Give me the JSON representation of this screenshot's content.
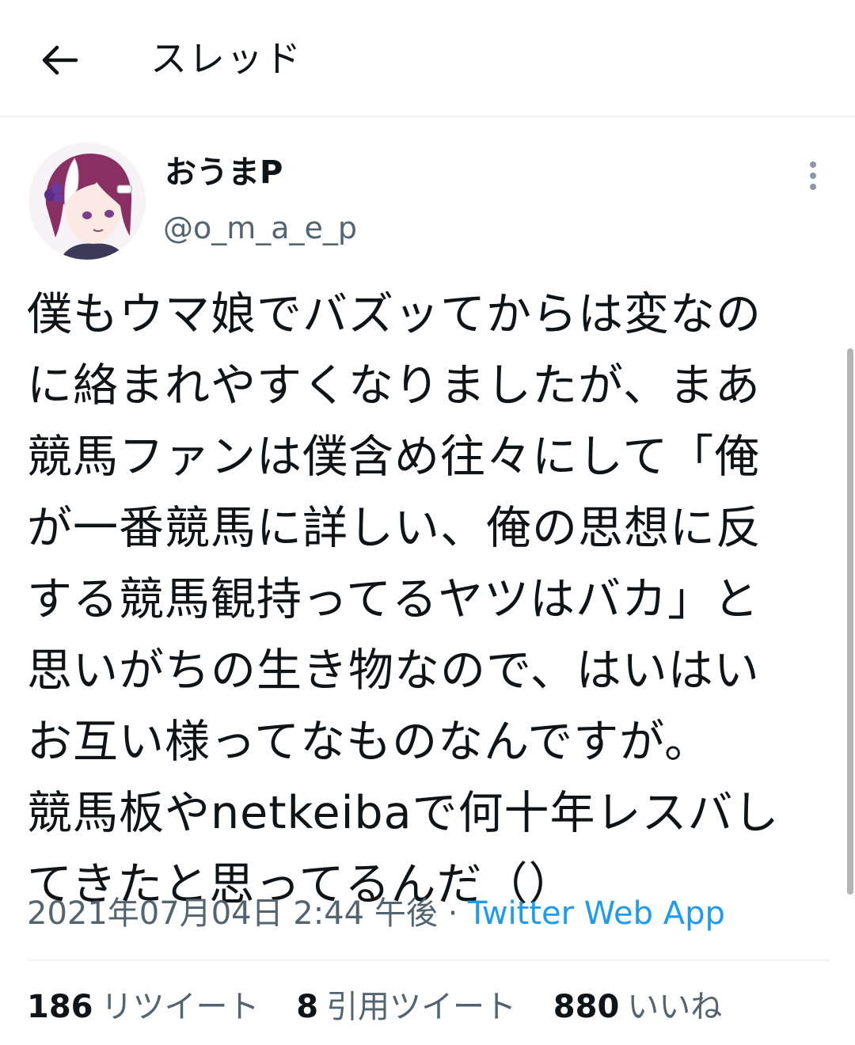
{
  "header": {
    "title": "スレッド",
    "back_icon": "arrow-left-icon"
  },
  "tweet": {
    "author": {
      "name": "おうまP",
      "handle": "@o_m_a_e_p"
    },
    "more_icon": "vertical-ellipsis-icon",
    "text_lines": [
      "僕もウマ娘でバズッてからは変なの",
      "に絡まれやすくなりましたが、まあ",
      "競馬ファンは僕含め往々にして「俺",
      "が一番競馬に詳しい、俺の思想に反",
      "する競馬観持ってるヤツはバカ」と",
      "思いがちの生き物なので、はいはい",
      "お互い様ってなものなんですが。",
      "競馬板やnetkeibaで何十年レスバし",
      "てきたと思ってるんだ（）"
    ],
    "timestamp": "2021年07月04日 2:44 午後",
    "separator": "·",
    "source": "Twitter Web App",
    "stats": {
      "retweets_count": "186",
      "retweets_label": "リツイート",
      "quotes_count": "8",
      "quotes_label": "引用ツイート",
      "likes_count": "880",
      "likes_label": "いいね"
    }
  },
  "colors": {
    "text": "#0f1419",
    "secondary": "#536471",
    "link": "#1d9bf0",
    "divider": "#eff3f4"
  }
}
